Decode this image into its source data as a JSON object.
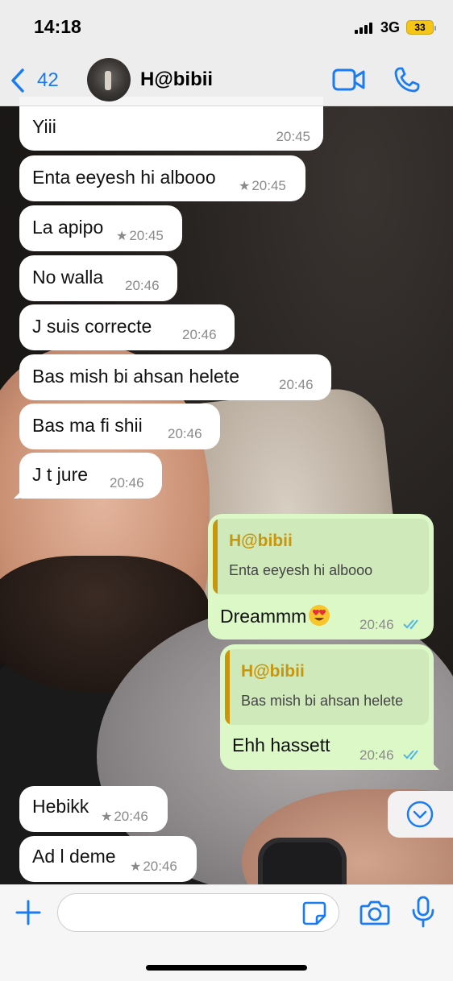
{
  "status_bar": {
    "time": "14:18",
    "network": "3G",
    "battery": "33"
  },
  "header": {
    "back_count": "42",
    "contact_name": "H@bibii",
    "icons": [
      "chevron-left-icon",
      "video-call-icon",
      "phone-icon"
    ],
    "accent_color": "#1a7cf0"
  },
  "messages": [
    {
      "direction": "in",
      "text": "Yiii",
      "time": "20:45",
      "starred": false
    },
    {
      "direction": "in",
      "text": "Enta eeyesh hi albooo",
      "time": "20:45",
      "starred": true
    },
    {
      "direction": "in",
      "text": "La apipo",
      "time": "20:45",
      "starred": true
    },
    {
      "direction": "in",
      "text": "No walla",
      "time": "20:46",
      "starred": false
    },
    {
      "direction": "in",
      "text": "J suis correcte",
      "time": "20:46",
      "starred": false
    },
    {
      "direction": "in",
      "text": "Bas mish bi ahsan helete",
      "time": "20:46",
      "starred": false
    },
    {
      "direction": "in",
      "text": "Bas ma fi shii",
      "time": "20:46",
      "starred": false
    },
    {
      "direction": "in",
      "text": "J t jure",
      "time": "20:46",
      "starred": false
    },
    {
      "direction": "out",
      "text": "Dreammm",
      "emoji": "heart-eyes-emoji",
      "time": "20:46",
      "read": true,
      "quote": {
        "name": "H@bibii",
        "text": "Enta eeyesh hi albooo"
      }
    },
    {
      "direction": "out",
      "text": "Ehh hassett",
      "time": "20:46",
      "read": true,
      "quote": {
        "name": "H@bibii",
        "text": "Bas mish bi ahsan helete"
      }
    },
    {
      "direction": "in",
      "text": "Hebikk",
      "time": "20:46",
      "starred": true
    },
    {
      "direction": "in",
      "text": "Ad l deme",
      "time": "20:46",
      "starred": true
    }
  ],
  "composer": {
    "input_value": "",
    "input_placeholder": "",
    "icons": [
      "plus-icon",
      "sticker-icon",
      "camera-icon",
      "microphone-icon"
    ]
  },
  "colors": {
    "incoming_bubble": "#ffffff",
    "outgoing_bubble": "#dcf8c6",
    "quote_accent": "#c8960c",
    "read_ticks": "#4fb6ec"
  }
}
